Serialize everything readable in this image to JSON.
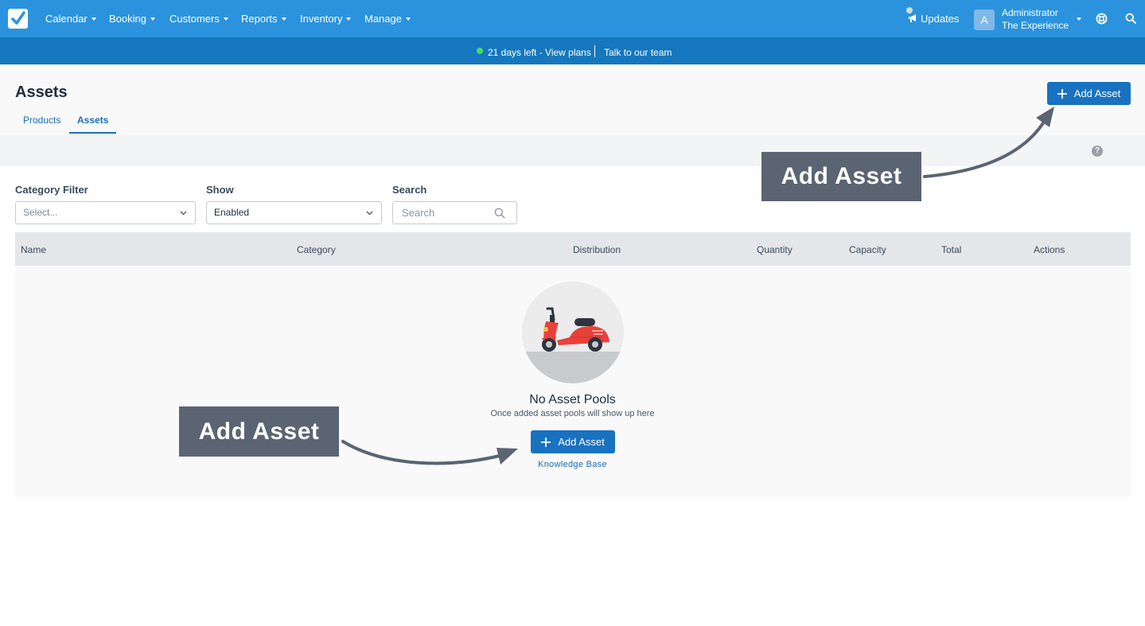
{
  "nav": {
    "items": [
      {
        "label": "Calendar"
      },
      {
        "label": "Booking"
      },
      {
        "label": "Customers"
      },
      {
        "label": "Reports"
      },
      {
        "label": "Inventory"
      },
      {
        "label": "Manage"
      }
    ],
    "updates_label": "Updates",
    "avatar_letter": "A",
    "user_name": "Administrator",
    "user_org": "The Experience"
  },
  "trial": {
    "days_text": "21 days left - View plans",
    "talk_text": "Talk to our team"
  },
  "page": {
    "title": "Assets",
    "tabs": [
      {
        "label": "Products"
      },
      {
        "label": "Assets"
      }
    ],
    "add_button_label": "Add Asset"
  },
  "filters": {
    "category_label": "Category Filter",
    "category_placeholder": "Select...",
    "show_label": "Show",
    "show_value": "Enabled",
    "search_label": "Search",
    "search_placeholder": "Search"
  },
  "table": {
    "columns": [
      "Name",
      "Category",
      "Distribution",
      "Quantity",
      "Capacity",
      "Total",
      "Actions"
    ]
  },
  "empty_state": {
    "title": "No Asset Pools",
    "subtitle": "Once added asset pools will show up here",
    "button_label": "Add Asset",
    "link_label": "Knowledge Base"
  },
  "callouts": {
    "top": "Add Asset",
    "bottom": "Add Asset"
  },
  "colors": {
    "nav_bg": "#2b93dd",
    "trial_bg": "#1577bd",
    "primary": "#1872c0",
    "callout_bg": "#5a6473",
    "scooter_red": "#e8413a"
  }
}
